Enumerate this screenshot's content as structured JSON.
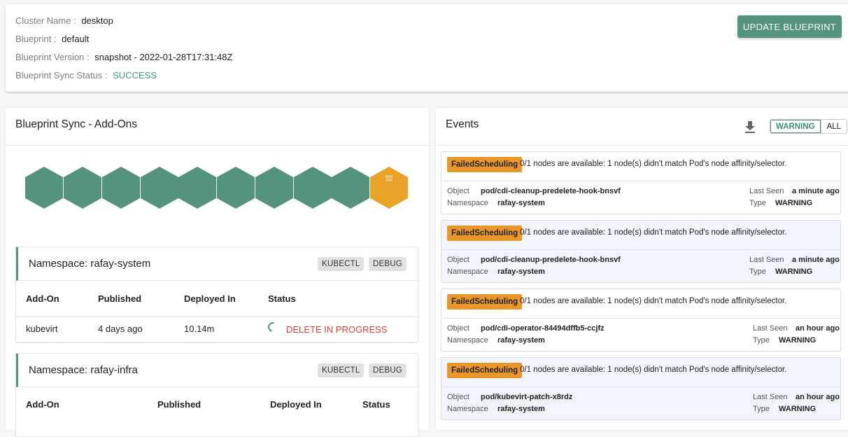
{
  "cluster_info": {
    "cluster_name_label": "Cluster Name :",
    "cluster_name": "desktop",
    "blueprint_label": "Blueprint :",
    "blueprint": "default",
    "blueprint_version_label": "Blueprint Version :",
    "blueprint_version": "snapshot - 2022-01-28T17:31:48Z",
    "sync_status_label": "Blueprint Sync Status :",
    "sync_status": "SUCCESS",
    "update_button": "UPDATE BLUEPRINT"
  },
  "addons_panel": {
    "title": "Blueprint Sync - Add-Ons",
    "hexagons": [
      {
        "status": "success"
      },
      {
        "status": "success"
      },
      {
        "status": "success"
      },
      {
        "status": "success"
      },
      {
        "status": "success"
      },
      {
        "status": "success"
      },
      {
        "status": "success"
      },
      {
        "status": "success"
      },
      {
        "status": "success"
      },
      {
        "status": "in-progress",
        "icon": "server-icon"
      }
    ],
    "namespaces": [
      {
        "title": "Namespace: rafay-system",
        "kubectl_label": "KUBECTL",
        "debug_label": "DEBUG",
        "columns": [
          "Add-On",
          "Published",
          "Deployed In",
          "Status"
        ],
        "rows": [
          {
            "addon": "kubevirt",
            "published": "4 days ago",
            "deployed_in": "10.14m",
            "status": "DELETE IN PROGRESS"
          }
        ]
      },
      {
        "title": "Namespace: rafay-infra",
        "kubectl_label": "KUBECTL",
        "debug_label": "DEBUG",
        "columns": [
          "Add-On",
          "Published",
          "Deployed In",
          "Status"
        ],
        "rows": []
      }
    ]
  },
  "events_panel": {
    "title": "Events",
    "download_icon": "download-icon",
    "filters": [
      "WARNING",
      "ALL"
    ],
    "active_filter": "WARNING",
    "labels": {
      "object": "Object",
      "namespace": "Namespace",
      "last_seen": "Last Seen",
      "type": "Type"
    },
    "events": [
      {
        "reason": "FailedScheduling",
        "message": "0/1 nodes are available: 1 node(s) didn't match Pod's node affinity/selector.",
        "object": "pod/cdi-cleanup-predelete-hook-bnsvf",
        "namespace": "rafay-system",
        "last_seen": "a minute ago",
        "type": "WARNING"
      },
      {
        "reason": "FailedScheduling",
        "message": "0/1 nodes are available: 1 node(s) didn't match Pod's node affinity/selector.",
        "object": "pod/cdi-cleanup-predelete-hook-bnsvf",
        "namespace": "rafay-system",
        "last_seen": "a minute ago",
        "type": "WARNING"
      },
      {
        "reason": "FailedScheduling",
        "message": "0/1 nodes are available: 1 node(s) didn't match Pod's node affinity/selector.",
        "object": "pod/cdi-operator-84494dffb5-ccjfz",
        "namespace": "rafay-system",
        "last_seen": "an hour ago",
        "type": "WARNING"
      },
      {
        "reason": "FailedScheduling",
        "message": "0/1 nodes are available: 1 node(s) didn't match Pod's node affinity/selector.",
        "object": "pod/kubevirt-patch-x8rdz",
        "namespace": "rafay-system",
        "last_seen": "an hour ago",
        "type": "WARNING"
      }
    ]
  },
  "colors": {
    "accent": "#53937f",
    "success_text": "#3e9a7f",
    "warning": "#e9a329",
    "danger": "#d9423a"
  }
}
